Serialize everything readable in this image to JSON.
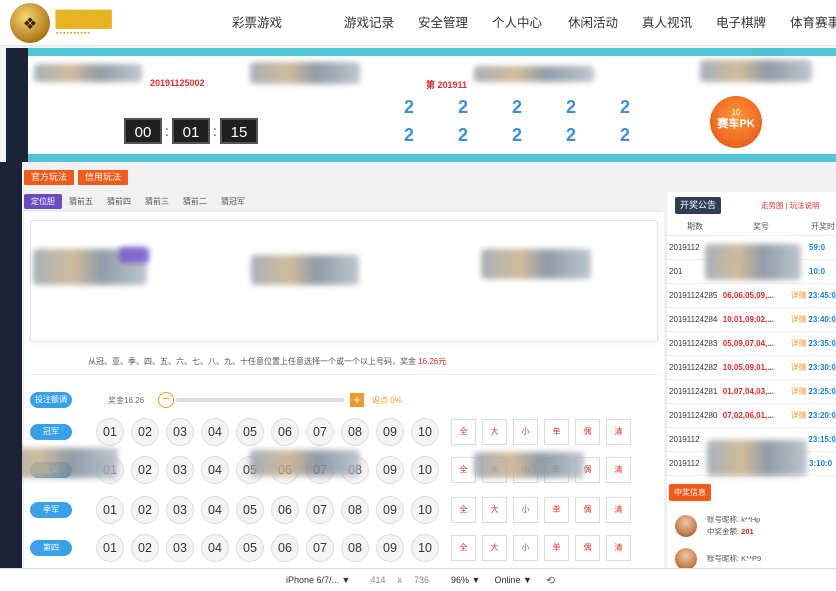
{
  "nav": {
    "logo_icon": "crest-logo-icon",
    "items": [
      "彩票游戏",
      "游戏记录",
      "安全管理",
      "个人中心",
      "休闲活动",
      "真人视讯",
      "电子棋牌",
      "体育赛事"
    ]
  },
  "banner": {
    "current_issue": "20191125002",
    "prev_issue": "第 201911",
    "timer": {
      "h": "00",
      "m": "01",
      "s": "15"
    },
    "results_row1": [
      "2",
      "2",
      "2",
      "2",
      "2"
    ],
    "results_row2": [
      "2",
      "2",
      "2",
      "2",
      "2"
    ],
    "game_badge": {
      "top": "10",
      "label": "赛车PK"
    }
  },
  "modes": [
    "官方玩法",
    "信用玩法"
  ],
  "sub_tabs": [
    "定位胆",
    "猜前五",
    "猜前四",
    "猜前三",
    "猜前二",
    "猜冠军"
  ],
  "rule": {
    "text": "从冠、亚、季、四、五、六、七、八、九、十任意位置上任意选择一个或一个以上号码，奖金 ",
    "amount": "16.26元"
  },
  "multiplier": {
    "pill": "投注额调",
    "label": "奖金16.26",
    "rebate": "返点 0%",
    "level": 0
  },
  "bet_rows": [
    {
      "label": "冠军",
      "numbers": [
        "01",
        "02",
        "03",
        "04",
        "05",
        "06",
        "07",
        "08",
        "09",
        "10"
      ]
    },
    {
      "label": "亚军",
      "numbers": [
        "01",
        "02",
        "03",
        "04",
        "05",
        "06",
        "07",
        "08",
        "09",
        "10"
      ]
    },
    {
      "label": "季军",
      "numbers": [
        "01",
        "02",
        "03",
        "04",
        "05",
        "06",
        "07",
        "08",
        "09",
        "10"
      ]
    },
    {
      "label": "第四",
      "numbers": [
        "01",
        "02",
        "03",
        "04",
        "05",
        "06",
        "07",
        "08",
        "09",
        "10"
      ]
    }
  ],
  "filters": [
    "全",
    "大",
    "小",
    "单",
    "偶",
    "清"
  ],
  "sidebar": {
    "tab": "开奖公告",
    "links": "走势图 | 玩法说明",
    "columns": [
      "期数",
      "奖号",
      "开奖时"
    ],
    "detail_label": "详情",
    "draws": [
      {
        "issue": "2019112",
        "nums": "",
        "time": "59:0"
      },
      {
        "issue": "201",
        "nums": "",
        "time": "10:0"
      },
      {
        "issue": "20191124285",
        "nums": "06,06,05,09,...",
        "time": "23:45:0"
      },
      {
        "issue": "20191124284",
        "nums": "10,01,09,02,...",
        "time": "23:40:0"
      },
      {
        "issue": "20191124283",
        "nums": "05,09,07,04,...",
        "time": "23:35:0"
      },
      {
        "issue": "20191124282",
        "nums": "10,05,09,01,...",
        "time": "23:30:0"
      },
      {
        "issue": "20191124281",
        "nums": "01,07,04,03,...",
        "time": "23:25:0"
      },
      {
        "issue": "20191124280",
        "nums": "07,02,06,01,...",
        "time": "23:20:0"
      },
      {
        "issue": "2019112",
        "nums": "",
        "time": "23:15:0"
      },
      {
        "issue": "2019112",
        "nums": "",
        "time": "3:10:0"
      }
    ],
    "winners_tab": "中奖信息",
    "winners": [
      {
        "account": "账号昵称: k**Hp",
        "amount_label": "中奖金额: ",
        "amount": "201"
      },
      {
        "account": "账号昵称: K**P9",
        "amount_label": "",
        "amount": ""
      }
    ]
  },
  "devbar": {
    "device": "iPhone 6/7/... ▼",
    "width": "414",
    "x": "x",
    "height": "736",
    "zoom": "96% ▼",
    "net": "Online ▼",
    "rotate_icon": "rotate-icon"
  }
}
